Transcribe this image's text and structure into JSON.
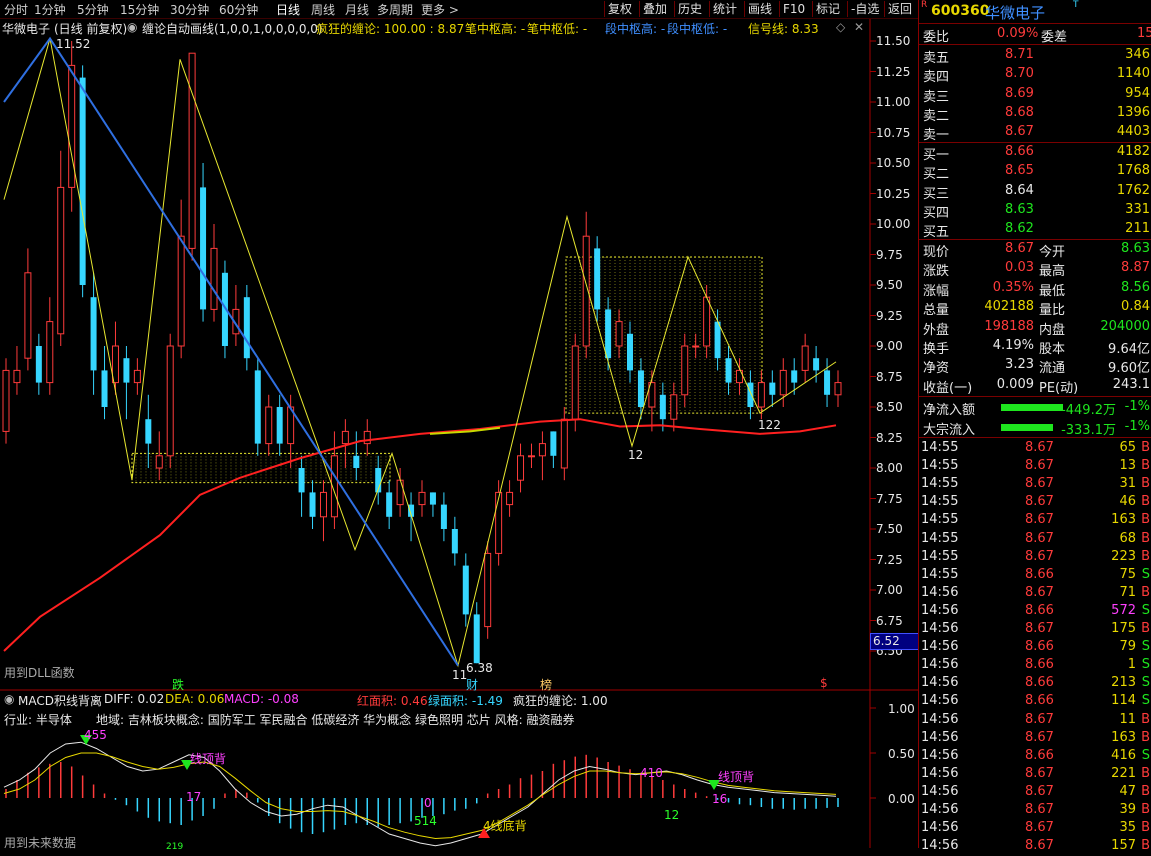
{
  "toolbar": {
    "periods": [
      "分时",
      "1分钟",
      "5分钟",
      "15分钟",
      "30分钟",
      "60分钟",
      "日线",
      "周线",
      "月线",
      "多周期",
      "更多 >"
    ],
    "active": "日线",
    "tools": [
      "复权",
      "叠加",
      "历史",
      "统计",
      "画线",
      "F10",
      "标记",
      "-自选",
      "返回"
    ]
  },
  "main_header": {
    "name": "华微电子",
    "mode": "(日线 前复权)",
    "indicator": "缠论自动画线(1,0,0,1,0,0,0,0,0)",
    "crazy": "疯狂的缠论: 100.00 : 8.87",
    "bi_high": "笔中枢高: -",
    "bi_low": "笔中枢低: -",
    "duan_high": "段中枢高: -",
    "duan_low": "段中枢低: -",
    "signal": "信号线: 8.33"
  },
  "price_axis": [
    "11.50",
    "11.25",
    "11.00",
    "10.75",
    "10.50",
    "10.25",
    "10.00",
    "9.75",
    "9.50",
    "9.25",
    "9.00",
    "8.75",
    "8.50",
    "8.25",
    "8.00",
    "7.75",
    "7.50",
    "7.25",
    "7.00",
    "6.75",
    "6.50"
  ],
  "current_price_tag": "6.52",
  "chart_labels": {
    "high_label": "11.52",
    "low_label": "6.38",
    "low_marker": "11",
    "label_12": "12",
    "label_122": "122",
    "dll": "用到DLL函数",
    "tag_die": "跌",
    "tag_cai": "财",
    "tag_bang": "榜",
    "tag_s": "$"
  },
  "macd": {
    "title": "MACD积线背离",
    "diff": "DIFF: 0.02",
    "dea": "DEA: 0.06",
    "macd": "MACD: -0.08",
    "red_area": "红面积: 0.46",
    "green_area": "绿面积: -1.49",
    "crazy": "疯狂的缠论: 1.00",
    "axis": [
      "1.00",
      "0.50",
      "0.00"
    ],
    "industry": "行业: 半导体",
    "region": "地域: 吉林板块概念: 国防军工 军民融合 低碳经济 华为概念 绿色照明 芯片 风格: 融资融券",
    "labels": [
      "455",
      "线顶背",
      "17",
      "0",
      "514",
      "4线底背",
      "410",
      "12",
      "线顶背",
      "16",
      "219"
    ],
    "future": "用到未来数据"
  },
  "quote": {
    "code": "600360",
    "name": "华微电子",
    "badge": "R",
    "weibi_label": "委比",
    "weibi": "0.09%",
    "weicha_label": "委差",
    "weicha": "15",
    "sells": [
      {
        "label": "卖五",
        "price": "8.71",
        "vol": "346"
      },
      {
        "label": "卖四",
        "price": "8.70",
        "vol": "1140"
      },
      {
        "label": "卖三",
        "price": "8.69",
        "vol": "954"
      },
      {
        "label": "卖二",
        "price": "8.68",
        "vol": "1396"
      },
      {
        "label": "卖一",
        "price": "8.67",
        "vol": "4403"
      }
    ],
    "buys": [
      {
        "label": "买一",
        "price": "8.66",
        "vol": "4182"
      },
      {
        "label": "买二",
        "price": "8.65",
        "vol": "1768"
      },
      {
        "label": "买三",
        "price": "8.64",
        "vol": "1762"
      },
      {
        "label": "买四",
        "price": "8.63",
        "vol": "331"
      },
      {
        "label": "买五",
        "price": "8.62",
        "vol": "211"
      }
    ],
    "stats": [
      {
        "l1": "现价",
        "v1": "8.67",
        "l2": "今开",
        "v2": "8.63"
      },
      {
        "l1": "涨跌",
        "v1": "0.03",
        "l2": "最高",
        "v2": "8.87"
      },
      {
        "l1": "涨幅",
        "v1": "0.35%",
        "l2": "最低",
        "v2": "8.56"
      },
      {
        "l1": "总量",
        "v1": "402188",
        "l2": "量比",
        "v2": "0.84"
      },
      {
        "l1": "外盘",
        "v1": "198188",
        "l2": "内盘",
        "v2": "204000"
      },
      {
        "l1": "换手",
        "v1": "4.19%",
        "l2": "股本",
        "v2": "9.64亿"
      },
      {
        "l1": "净资",
        "v1": "3.23",
        "l2": "流通",
        "v2": "9.60亿"
      },
      {
        "l1": "收益(一)",
        "v1": "0.009",
        "l2": "PE(动)",
        "v2": "243.1"
      }
    ],
    "flows": [
      {
        "label": "净流入额",
        "value": "-449.2万",
        "pct": "-1%"
      },
      {
        "label": "大宗流入",
        "value": "-333.1万",
        "pct": "-1%"
      }
    ],
    "ticks": [
      {
        "t": "14:55",
        "p": "8.67",
        "v": "65",
        "d": "B"
      },
      {
        "t": "14:55",
        "p": "8.67",
        "v": "13",
        "d": "B"
      },
      {
        "t": "14:55",
        "p": "8.67",
        "v": "31",
        "d": "B"
      },
      {
        "t": "14:55",
        "p": "8.67",
        "v": "46",
        "d": "B"
      },
      {
        "t": "14:55",
        "p": "8.67",
        "v": "163",
        "d": "B"
      },
      {
        "t": "14:55",
        "p": "8.67",
        "v": "68",
        "d": "B"
      },
      {
        "t": "14:55",
        "p": "8.67",
        "v": "223",
        "d": "B"
      },
      {
        "t": "14:55",
        "p": "8.66",
        "v": "75",
        "d": "S"
      },
      {
        "t": "14:56",
        "p": "8.67",
        "v": "71",
        "d": "B"
      },
      {
        "t": "14:56",
        "p": "8.66",
        "v": "572",
        "d": "S"
      },
      {
        "t": "14:56",
        "p": "8.67",
        "v": "175",
        "d": "B"
      },
      {
        "t": "14:56",
        "p": "8.66",
        "v": "79",
        "d": "S"
      },
      {
        "t": "14:56",
        "p": "8.66",
        "v": "1",
        "d": "S"
      },
      {
        "t": "14:56",
        "p": "8.66",
        "v": "213",
        "d": "S"
      },
      {
        "t": "14:56",
        "p": "8.66",
        "v": "114",
        "d": "S"
      },
      {
        "t": "14:56",
        "p": "8.67",
        "v": "11",
        "d": "B"
      },
      {
        "t": "14:56",
        "p": "8.67",
        "v": "163",
        "d": "B"
      },
      {
        "t": "14:56",
        "p": "8.66",
        "v": "416",
        "d": "S"
      },
      {
        "t": "14:56",
        "p": "8.67",
        "v": "221",
        "d": "B"
      },
      {
        "t": "14:56",
        "p": "8.67",
        "v": "47",
        "d": "B"
      },
      {
        "t": "14:56",
        "p": "8.67",
        "v": "39",
        "d": "B"
      },
      {
        "t": "14:56",
        "p": "8.67",
        "v": "35",
        "d": "B"
      },
      {
        "t": "14:56",
        "p": "8.67",
        "v": "157",
        "d": "B"
      }
    ]
  },
  "colors": {
    "up": "#ff3b3b",
    "down": "#36d6ff",
    "ma": "#ff2020",
    "zigzag": "#e8e830",
    "trend": "#2f6fe0"
  }
}
